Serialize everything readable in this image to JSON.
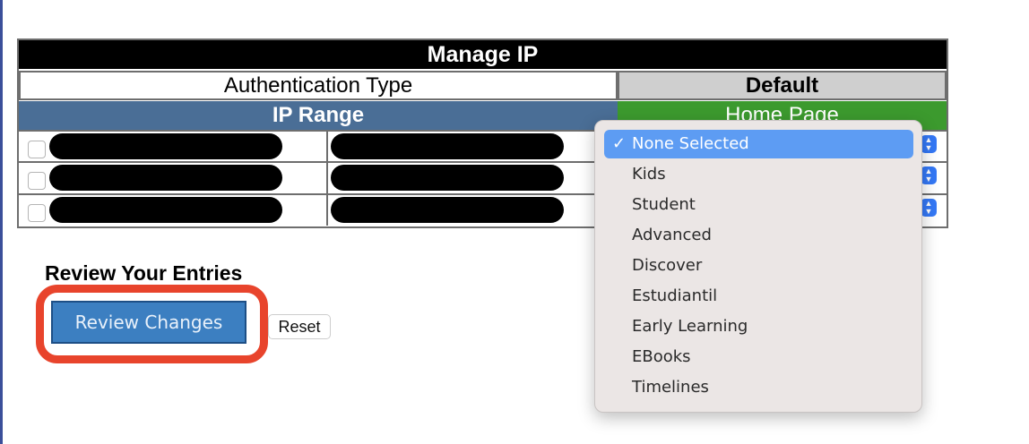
{
  "table": {
    "title": "Manage IP",
    "auth_type_label": "Authentication Type",
    "default_label": "Default",
    "ip_range_header": "IP Range",
    "home_page_header": "Home Page"
  },
  "review": {
    "heading": "Review Your Entries",
    "review_button": "Review Changes",
    "reset_button": "Reset"
  },
  "dropdown": {
    "selected_index": 0,
    "checkmark": "✓",
    "options": [
      "None Selected",
      "Kids",
      "Student",
      "Advanced",
      "Discover",
      "Estudiantil",
      "Early Learning",
      "EBooks",
      "Timelines"
    ]
  },
  "colors": {
    "title_bg": "#000000",
    "ip_range_bg": "#4a6e96",
    "home_page_bg": "#3c9a2e",
    "default_bg": "#cfcfcf",
    "highlight": "#e8442c",
    "selected_option": "#5d9cf3"
  },
  "icons": {
    "row_select": "checkbox",
    "select_arrows": "stepper-arrows-icon"
  }
}
